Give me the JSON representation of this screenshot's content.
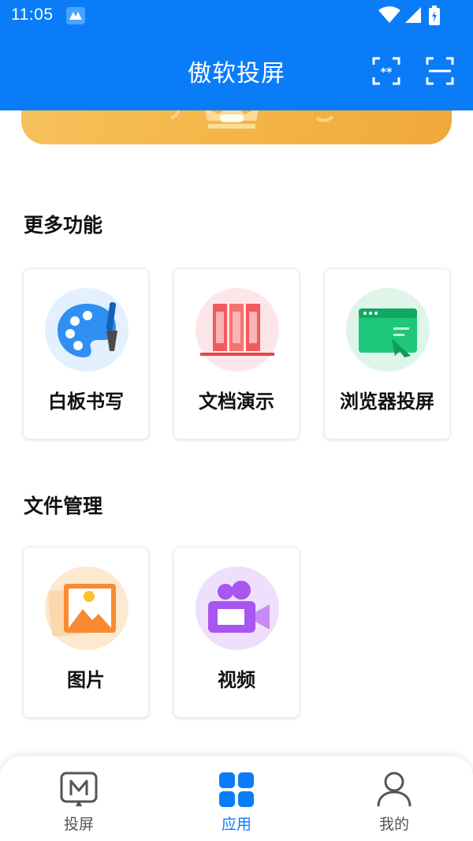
{
  "status_bar": {
    "time": "11:05"
  },
  "header": {
    "title": "傲软投屏",
    "actions": [
      {
        "name": "pin-code-connect-icon"
      },
      {
        "name": "scan-connect-icon"
      }
    ]
  },
  "sections": [
    {
      "title": "更多功能",
      "items": [
        {
          "label": "白板书写",
          "icon": "palette-icon"
        },
        {
          "label": "文档演示",
          "icon": "document-binders-icon"
        },
        {
          "label": "浏览器投屏",
          "icon": "browser-window-icon"
        }
      ]
    },
    {
      "title": "文件管理",
      "items": [
        {
          "label": "图片",
          "icon": "picture-icon"
        },
        {
          "label": "视频",
          "icon": "video-camera-icon"
        }
      ]
    }
  ],
  "bottom_nav": {
    "items": [
      {
        "label": "投屏",
        "icon": "cast-icon",
        "active": false
      },
      {
        "label": "应用",
        "icon": "apps-grid-icon",
        "active": true
      },
      {
        "label": "我的",
        "icon": "person-icon",
        "active": false
      }
    ]
  },
  "colors": {
    "primary": "#0a7cf8",
    "banner": "#f4b547",
    "nav_active": "#0a7cf8",
    "nav_inactive": "#555555"
  }
}
